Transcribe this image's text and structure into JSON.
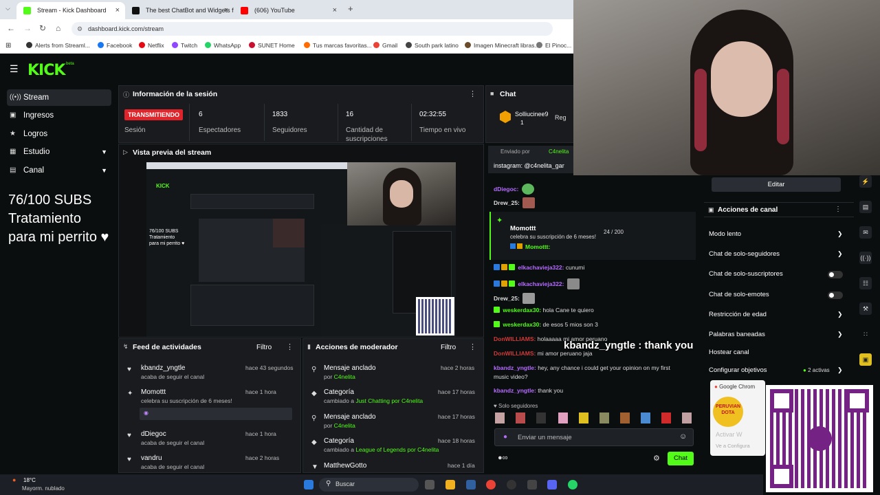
{
  "browser": {
    "tabs": [
      {
        "label": "Stream - Kick Dashboard",
        "color": "#53fc18"
      },
      {
        "label": "The best ChatBot and Widgets f",
        "color": "#111111"
      },
      {
        "label": "(606) YouTube",
        "color": "#ff0000"
      }
    ],
    "url": "dashboard.kick.com/stream",
    "bookmarks": [
      {
        "label": "Alerts from Streaml...",
        "color": "#333333"
      },
      {
        "label": "Facebook",
        "color": "#1877f2"
      },
      {
        "label": "Netflix",
        "color": "#e50914"
      },
      {
        "label": "Twitch",
        "color": "#9146ff"
      },
      {
        "label": "WhatsApp",
        "color": "#25d366"
      },
      {
        "label": "SUNET Home",
        "color": "#c8102e"
      },
      {
        "label": "Tus marcas favoritas...",
        "color": "#ff6b00"
      },
      {
        "label": "Gmail",
        "color": "#ea4335"
      },
      {
        "label": "South park latino",
        "color": "#444444"
      },
      {
        "label": "Imagen Minecraft libras...",
        "color": "#6a4b2a"
      },
      {
        "label": "El Pinoc...",
        "color": "#777777"
      }
    ]
  },
  "kick": {
    "logo": "KICK",
    "logo_sup": "beta",
    "sidebar": [
      {
        "label": "Stream",
        "icon": "broadcast-icon"
      },
      {
        "label": "Ingresos",
        "icon": "money-icon"
      },
      {
        "label": "Logros",
        "icon": "trophy-icon"
      },
      {
        "label": "Estudio",
        "icon": "studio-icon"
      },
      {
        "label": "Canal",
        "icon": "channel-icon"
      }
    ],
    "overlay_text": [
      "76/100 SUBS",
      "Tratamiento",
      "para mi perrito ♥"
    ]
  },
  "session": {
    "title": "Información de la sesión",
    "badge": "TRANSMITIENDO",
    "badge_label": "Sesión",
    "stats": [
      {
        "value": "6",
        "label": "Espectadores"
      },
      {
        "value": "1833",
        "label": "Seguidores"
      },
      {
        "value": "16",
        "label": "Cantidad de suscripciones"
      },
      {
        "value": "02:32:55",
        "label": "Tiempo en vivo"
      }
    ]
  },
  "preview": {
    "title": "Vista previa del stream",
    "overlay_text": [
      "76/100 SUBS",
      "Tratamiento",
      "para mi perrito ♥"
    ]
  },
  "activity": {
    "title": "Feed de actividades",
    "filter": "Filtro",
    "items": [
      {
        "name": "kbandz_yngtle",
        "sub": "acaba de seguir el canal",
        "time": "hace 43 segundos",
        "icon": "heart-icon"
      },
      {
        "name": "Momottt",
        "sub": "celebra su suscripción de 6 meses!",
        "time": "hace 1 hora",
        "icon": "star-icon"
      },
      {
        "name": "dDiegoc",
        "sub": "acaba de seguir el canal",
        "time": "hace 1 hora",
        "icon": "heart-icon"
      },
      {
        "name": "vandru",
        "sub": "acaba de seguir el canal",
        "time": "hace 2 horas",
        "icon": "heart-icon"
      }
    ]
  },
  "modactions": {
    "title": "Acciones de moderador",
    "filter": "Filtro",
    "items": [
      {
        "name": "Mensaje anclado",
        "sub_pre": "por",
        "sub_hl": "C4nelita",
        "sub_post": "",
        "time": "hace 2 horas",
        "icon": "pin-icon"
      },
      {
        "name": "Categoría",
        "sub_pre": "cambiado a",
        "sub_hl": "Just Chatting",
        "sub_post": "por C4nelita",
        "time": "hace 17 horas",
        "icon": "tag-icon"
      },
      {
        "name": "Mensaje anclado",
        "sub_pre": "por",
        "sub_hl": "C4nelita",
        "sub_post": "",
        "time": "hace 17 horas",
        "icon": "pin-icon"
      },
      {
        "name": "Categoría",
        "sub_pre": "cambiado a",
        "sub_hl": "League of Legends",
        "sub_post": "por C4nelita",
        "time": "hace 18 horas",
        "icon": "tag-icon"
      },
      {
        "name": "MatthewGotto",
        "sub_pre": "",
        "sub_hl": "",
        "sub_post": "",
        "time": "hace 1 día",
        "icon": "chevron-down-icon"
      }
    ]
  },
  "chat": {
    "title": "Chat",
    "top_user": "Solliucinee9",
    "top_count": "1",
    "top_right": "Reg",
    "pinned_by": "Enviado por",
    "pinned_user": "C4nelita",
    "pinned_text": "instagram: @c4nelita_gar",
    "sub_event_name": "Momottt",
    "sub_event_text": "celebra su suscripción de 6 meses!",
    "sub_event_count": "24 / 200",
    "sub_event_reply": "Momottt:",
    "lines": [
      {
        "user": "dDiegoc:",
        "text": "",
        "style": "purple"
      },
      {
        "user": "Drew_25:",
        "text": "",
        "style": "light"
      },
      {
        "user": "elkachavieja322:",
        "text": "cunumi",
        "style": "purple"
      },
      {
        "user": "elkachavieja322:",
        "text": "",
        "style": "purple"
      },
      {
        "user": "Drew_25:",
        "text": "",
        "style": "light"
      },
      {
        "user": "weskerdax30:",
        "text": "hola Cane te quiero",
        "style": "normal"
      },
      {
        "user": "weskerdax30:",
        "text": "de esos 5 mios son 3",
        "style": "normal"
      },
      {
        "user": "DonWILLIAMS:",
        "text": "holaaaaa mi amor peruano",
        "style": "red"
      },
      {
        "user": "DonWILLIAMS:",
        "text": "mi amor peruano jaja",
        "style": "red"
      },
      {
        "user": "kbandz_yngtle:",
        "text": "hey, any chance i could get your opinion on my first",
        "style": "purple"
      },
      {
        "user": "",
        "text": "music video?",
        "style": "none"
      },
      {
        "user": "kbandz_yngtle:",
        "text": "thank you",
        "style": "purple"
      }
    ],
    "overlay_caption_user": "kbandz_yngtle :",
    "overlay_caption_text": "thank you",
    "followers_only": "Solo seguidores",
    "input_placeholder": "Enviar un mensaje",
    "send_button": "Chat"
  },
  "channel_actions": {
    "edit_button": "Editar",
    "title": "Acciones de canal",
    "rows": [
      {
        "label": "Modo lento",
        "control": "chevron"
      },
      {
        "label": "Chat de solo-seguidores",
        "control": "chevron"
      },
      {
        "label": "Chat de solo-suscriptores",
        "control": "toggle"
      },
      {
        "label": "Chat de solo-emotes",
        "control": "toggle"
      },
      {
        "label": "Restricción de edad",
        "control": "chevron"
      },
      {
        "label": "Palabras baneadas",
        "control": "chevron"
      },
      {
        "label": "Hostear canal",
        "control": "none"
      },
      {
        "label": "Configurar objetivos",
        "control": "chevron"
      }
    ],
    "goals_active": "2 activas"
  },
  "taskbar": {
    "weather_temp": "18°C",
    "weather_desc": "Mayorm. nublado",
    "search": "Buscar"
  },
  "popup": {
    "source": "Google Chrom",
    "brand": "PERUVIAN DOTA",
    "activate": "Activar W",
    "goto": "Ve a Configura"
  }
}
